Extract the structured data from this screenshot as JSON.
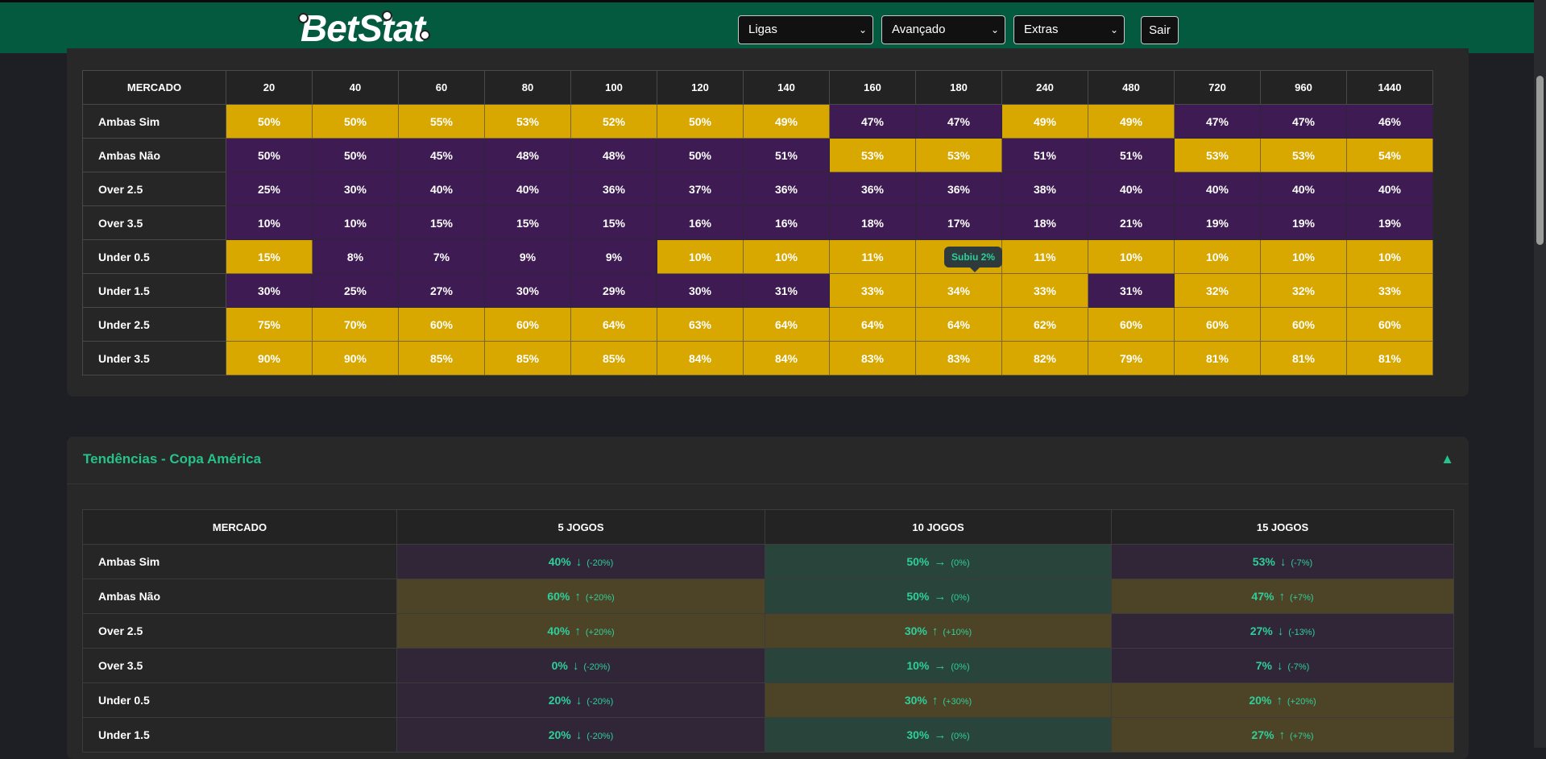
{
  "header": {
    "logo_text": "BetStat",
    "selects": [
      "Ligas",
      "Avançado",
      "Extras"
    ],
    "logout_label": "Sair"
  },
  "table1": {
    "columns": [
      "MERCADO",
      "20",
      "40",
      "60",
      "80",
      "100",
      "120",
      "140",
      "160",
      "180",
      "240",
      "480",
      "720",
      "960",
      "1440"
    ],
    "rows": [
      {
        "label": "Ambas Sim",
        "cells": [
          [
            "50%",
            "y"
          ],
          [
            "50%",
            "y"
          ],
          [
            "55%",
            "y"
          ],
          [
            "53%",
            "y"
          ],
          [
            "52%",
            "y"
          ],
          [
            "50%",
            "y"
          ],
          [
            "49%",
            "y"
          ],
          [
            "47%",
            "p"
          ],
          [
            "47%",
            "p"
          ],
          [
            "49%",
            "y"
          ],
          [
            "49%",
            "y"
          ],
          [
            "47%",
            "p"
          ],
          [
            "47%",
            "p"
          ],
          [
            "46%",
            "p"
          ]
        ]
      },
      {
        "label": "Ambas Não",
        "cells": [
          [
            "50%",
            "p"
          ],
          [
            "50%",
            "p"
          ],
          [
            "45%",
            "p"
          ],
          [
            "48%",
            "p"
          ],
          [
            "48%",
            "p"
          ],
          [
            "50%",
            "p"
          ],
          [
            "51%",
            "p"
          ],
          [
            "53%",
            "y"
          ],
          [
            "53%",
            "y"
          ],
          [
            "51%",
            "p"
          ],
          [
            "51%",
            "p"
          ],
          [
            "53%",
            "y"
          ],
          [
            "53%",
            "y"
          ],
          [
            "54%",
            "y"
          ]
        ]
      },
      {
        "label": "Over 2.5",
        "cells": [
          [
            "25%",
            "p"
          ],
          [
            "30%",
            "p"
          ],
          [
            "40%",
            "p"
          ],
          [
            "40%",
            "p"
          ],
          [
            "36%",
            "p"
          ],
          [
            "37%",
            "p"
          ],
          [
            "36%",
            "p"
          ],
          [
            "36%",
            "p"
          ],
          [
            "36%",
            "p"
          ],
          [
            "38%",
            "p"
          ],
          [
            "40%",
            "p"
          ],
          [
            "40%",
            "p"
          ],
          [
            "40%",
            "p"
          ],
          [
            "40%",
            "p"
          ]
        ]
      },
      {
        "label": "Over 3.5",
        "cells": [
          [
            "10%",
            "p"
          ],
          [
            "10%",
            "p"
          ],
          [
            "15%",
            "p"
          ],
          [
            "15%",
            "p"
          ],
          [
            "15%",
            "p"
          ],
          [
            "16%",
            "p"
          ],
          [
            "16%",
            "p"
          ],
          [
            "18%",
            "p"
          ],
          [
            "17%",
            "p"
          ],
          [
            "18%",
            "p"
          ],
          [
            "21%",
            "p"
          ],
          [
            "19%",
            "p"
          ],
          [
            "19%",
            "p"
          ],
          [
            "19%",
            "p"
          ]
        ]
      },
      {
        "label": "Under 0.5",
        "cells": [
          [
            "15%",
            "y"
          ],
          [
            "8%",
            "p"
          ],
          [
            "7%",
            "p"
          ],
          [
            "9%",
            "p"
          ],
          [
            "9%",
            "p"
          ],
          [
            "10%",
            "y"
          ],
          [
            "10%",
            "y"
          ],
          [
            "11%",
            "y"
          ],
          [
            "",
            "y"
          ],
          [
            "11%",
            "y"
          ],
          [
            "10%",
            "y"
          ],
          [
            "10%",
            "y"
          ],
          [
            "10%",
            "y"
          ],
          [
            "10%",
            "y"
          ]
        ]
      },
      {
        "label": "Under 1.5",
        "cells": [
          [
            "30%",
            "p"
          ],
          [
            "25%",
            "p"
          ],
          [
            "27%",
            "p"
          ],
          [
            "30%",
            "p"
          ],
          [
            "29%",
            "p"
          ],
          [
            "30%",
            "p"
          ],
          [
            "31%",
            "p"
          ],
          [
            "33%",
            "y"
          ],
          [
            "34%",
            "y"
          ],
          [
            "33%",
            "y"
          ],
          [
            "31%",
            "p"
          ],
          [
            "32%",
            "y"
          ],
          [
            "32%",
            "y"
          ],
          [
            "33%",
            "y"
          ]
        ]
      },
      {
        "label": "Under 2.5",
        "cells": [
          [
            "75%",
            "y"
          ],
          [
            "70%",
            "y"
          ],
          [
            "60%",
            "y"
          ],
          [
            "60%",
            "y"
          ],
          [
            "64%",
            "y"
          ],
          [
            "63%",
            "y"
          ],
          [
            "64%",
            "y"
          ],
          [
            "64%",
            "y"
          ],
          [
            "64%",
            "y"
          ],
          [
            "62%",
            "y"
          ],
          [
            "60%",
            "y"
          ],
          [
            "60%",
            "y"
          ],
          [
            "60%",
            "y"
          ],
          [
            "60%",
            "y"
          ]
        ]
      },
      {
        "label": "Under 3.5",
        "cells": [
          [
            "90%",
            "y"
          ],
          [
            "90%",
            "y"
          ],
          [
            "85%",
            "y"
          ],
          [
            "85%",
            "y"
          ],
          [
            "85%",
            "y"
          ],
          [
            "84%",
            "y"
          ],
          [
            "84%",
            "y"
          ],
          [
            "83%",
            "y"
          ],
          [
            "83%",
            "y"
          ],
          [
            "82%",
            "y"
          ],
          [
            "79%",
            "y"
          ],
          [
            "81%",
            "y"
          ],
          [
            "81%",
            "y"
          ],
          [
            "81%",
            "y"
          ]
        ]
      }
    ],
    "tooltip": "Subiu 2%"
  },
  "panel2": {
    "title": "Tendências - Copa América",
    "caret": "▲",
    "columns": [
      "MERCADO",
      "5 JOGOS",
      "10 JOGOS",
      "15 JOGOS"
    ],
    "rows": [
      {
        "label": "Ambas Sim",
        "cells": [
          [
            "40%",
            "↓",
            "(-20%)",
            "dn"
          ],
          [
            "50%",
            "→",
            "(0%)",
            "eq"
          ],
          [
            "53%",
            "↓",
            "(-7%)",
            "dn"
          ]
        ]
      },
      {
        "label": "Ambas Não",
        "cells": [
          [
            "60%",
            "↑",
            "(+20%)",
            "up"
          ],
          [
            "50%",
            "→",
            "(0%)",
            "eq"
          ],
          [
            "47%",
            "↑",
            "(+7%)",
            "up"
          ]
        ]
      },
      {
        "label": "Over 2.5",
        "cells": [
          [
            "40%",
            "↑",
            "(+20%)",
            "up"
          ],
          [
            "30%",
            "↑",
            "(+10%)",
            "up"
          ],
          [
            "27%",
            "↓",
            "(-13%)",
            "dn"
          ]
        ]
      },
      {
        "label": "Over 3.5",
        "cells": [
          [
            "0%",
            "↓",
            "(-20%)",
            "dn"
          ],
          [
            "10%",
            "→",
            "(0%)",
            "eq"
          ],
          [
            "7%",
            "↓",
            "(-7%)",
            "dn"
          ]
        ]
      },
      {
        "label": "Under 0.5",
        "cells": [
          [
            "20%",
            "↓",
            "(-20%)",
            "dn"
          ],
          [
            "30%",
            "↑",
            "(+30%)",
            "up"
          ],
          [
            "20%",
            "↑",
            "(+20%)",
            "up"
          ]
        ]
      },
      {
        "label": "Under 1.5",
        "cells": [
          [
            "20%",
            "↓",
            "(-20%)",
            "dn"
          ],
          [
            "30%",
            "→",
            "(0%)",
            "eq"
          ],
          [
            "27%",
            "↑",
            "(+7%)",
            "up"
          ]
        ]
      }
    ]
  },
  "colors": {
    "header_bg": "#045a3f",
    "yellow_cell": "#d8a800",
    "purple_cell": "#3f1b53",
    "accent_green": "#25c28a"
  }
}
